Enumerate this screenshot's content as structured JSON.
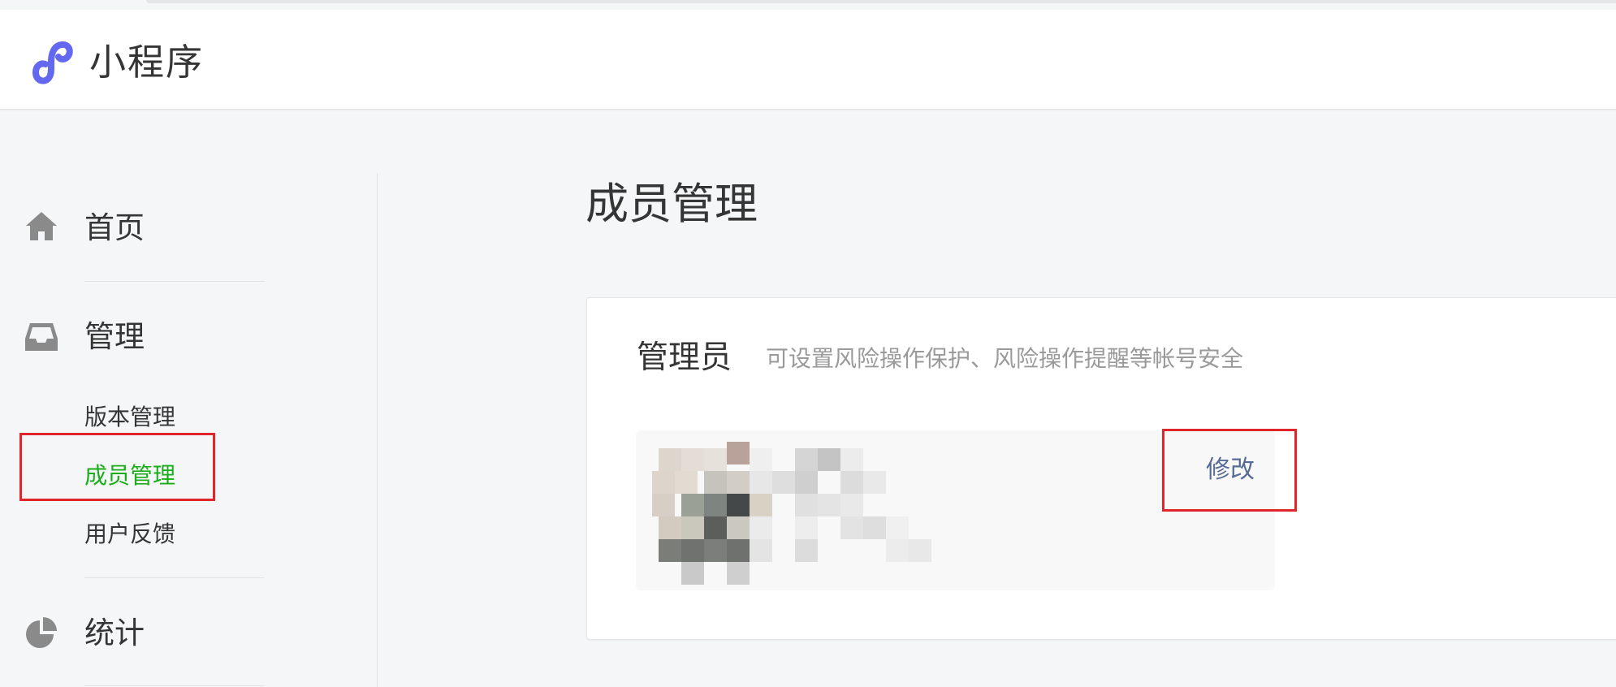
{
  "header": {
    "brand": "小程序",
    "logo_icon": "mini-program-logo-icon"
  },
  "sidebar": {
    "items": [
      {
        "label": "首页",
        "icon": "home-icon"
      },
      {
        "label": "管理",
        "icon": "inbox-icon",
        "children": [
          {
            "label": "版本管理",
            "active": false
          },
          {
            "label": "成员管理",
            "active": true
          },
          {
            "label": "用户反馈",
            "active": false
          }
        ]
      },
      {
        "label": "统计",
        "icon": "pie-chart-icon"
      }
    ]
  },
  "main": {
    "title": "成员管理",
    "admin_card": {
      "title": "管理员",
      "description": "可设置风险操作保护、风险操作提醒等帐号安全",
      "edit_label": "修改"
    }
  },
  "colors": {
    "accent_active": "#1aad19",
    "link": "#576b95",
    "highlight_border": "#e0262a",
    "logo": "#6467f0"
  }
}
